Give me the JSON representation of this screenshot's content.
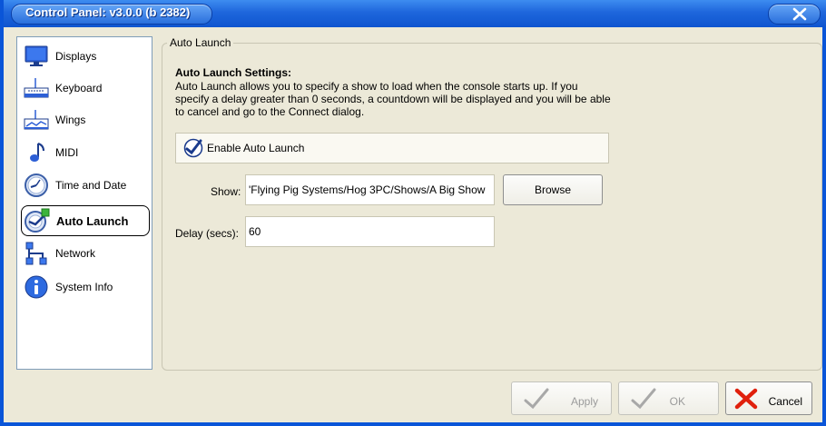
{
  "window": {
    "title": "Control Panel: v3.0.0 (b 2382)"
  },
  "sidebar": {
    "items": [
      {
        "label": "Displays",
        "icon": "monitor-icon"
      },
      {
        "label": "Keyboard",
        "icon": "keyboard-icon"
      },
      {
        "label": "Wings",
        "icon": "wings-icon"
      },
      {
        "label": "MIDI",
        "icon": "music-note-icon"
      },
      {
        "label": "Time and Date",
        "icon": "clock-icon"
      },
      {
        "label": "Auto Launch",
        "icon": "auto-launch-icon"
      },
      {
        "label": "Network",
        "icon": "network-icon"
      },
      {
        "label": "System Info",
        "icon": "info-icon"
      }
    ],
    "selected": "Auto Launch"
  },
  "panel": {
    "group_title": "Auto Launch",
    "heading": "Auto Launch Settings:",
    "description": "Auto Launch allows you to specify a show to load when the console starts up. If you specify a delay greater than 0 seconds, a countdown will be displayed and you will be able to cancel and go to the Connect dialog.",
    "enable_label": "Enable Auto Launch",
    "enable_checked": true,
    "show_label": "Show:",
    "show_value": "'Flying Pig Systems/Hog 3PC/Shows/A Big Show",
    "browse_label": "Browse",
    "delay_label": "Delay (secs):",
    "delay_value": "60"
  },
  "footer": {
    "apply_label": "Apply",
    "ok_label": "OK",
    "cancel_label": "Cancel"
  },
  "colors": {
    "titlebar": "#1e66dc",
    "window_bg": "#ece9d8",
    "check_blue": "#1a3a8c",
    "cancel_red": "#e0200c"
  }
}
